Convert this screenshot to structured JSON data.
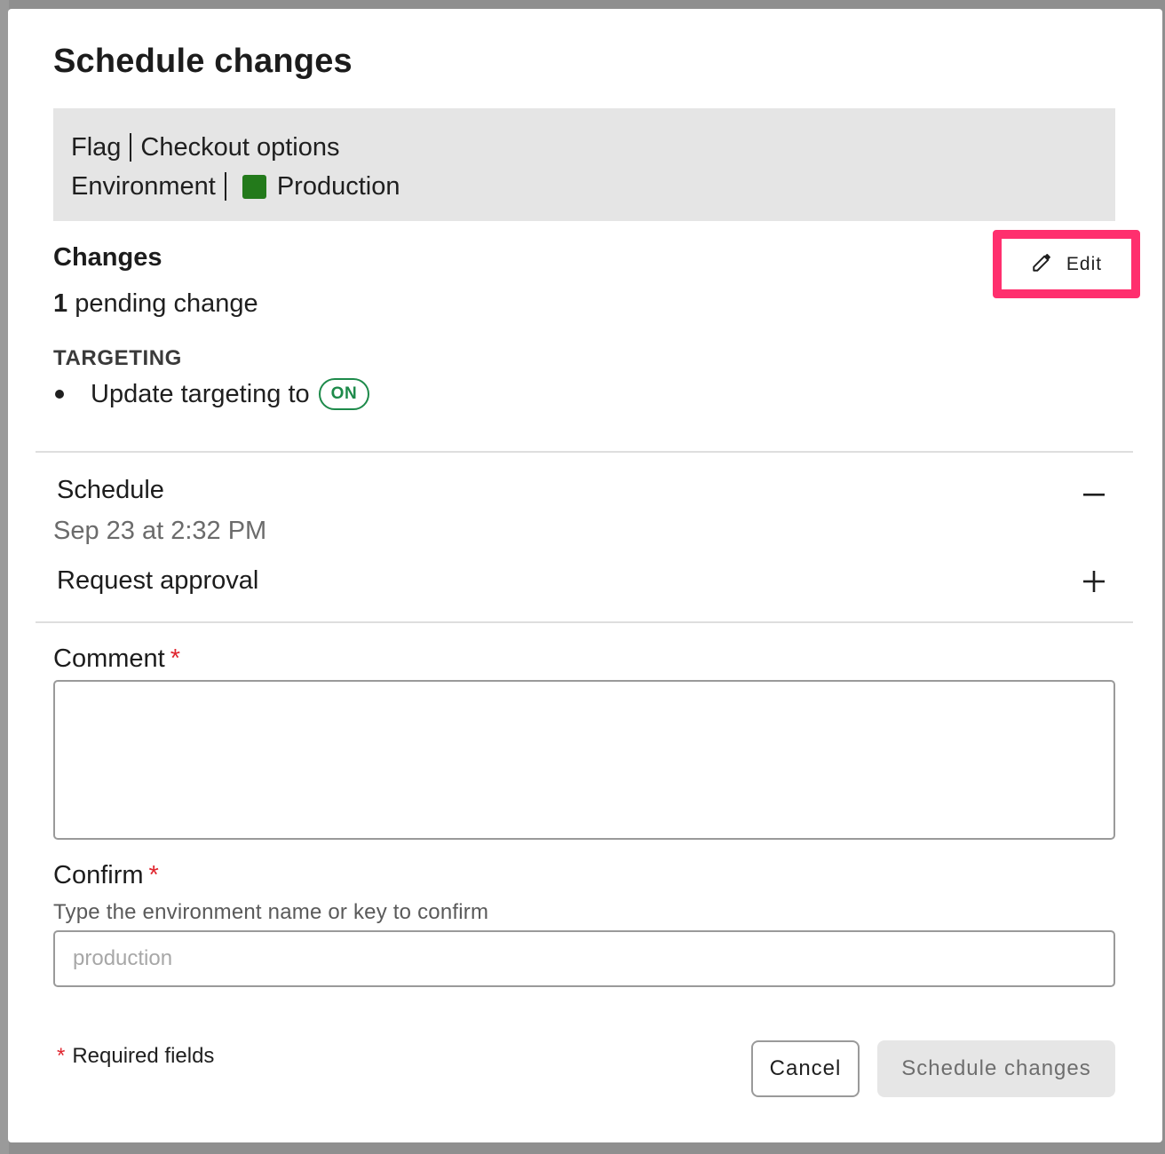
{
  "modal": {
    "title": "Schedule changes",
    "info": {
      "flag_label": "Flag",
      "flag_value": "Checkout options",
      "environment_label": "Environment",
      "environment_value": "Production",
      "environment_color": "#237a1b"
    },
    "changes": {
      "title": "Changes",
      "edit_label": "Edit",
      "pending_count": "1",
      "pending_text": "pending change",
      "section_heading": "TARGETING",
      "item_text": "Update targeting to",
      "item_badge": "ON",
      "badge_color": "#1d8a4a"
    },
    "schedule": {
      "label": "Schedule",
      "date": "Sep 23 at 2:32 PM",
      "toggle_icon": "minus-icon"
    },
    "approval": {
      "label": "Request approval",
      "toggle_icon": "plus-icon"
    },
    "comment": {
      "label": "Comment",
      "required_mark": "*",
      "value": ""
    },
    "confirm": {
      "label": "Confirm",
      "required_mark": "*",
      "hint": "Type the environment name or key to confirm",
      "placeholder": "production",
      "value": ""
    },
    "footer": {
      "required_mark": "*",
      "required_note": "Required fields",
      "cancel_label": "Cancel",
      "submit_label": "Schedule changes"
    },
    "highlight_color": "#ff2f6e"
  }
}
